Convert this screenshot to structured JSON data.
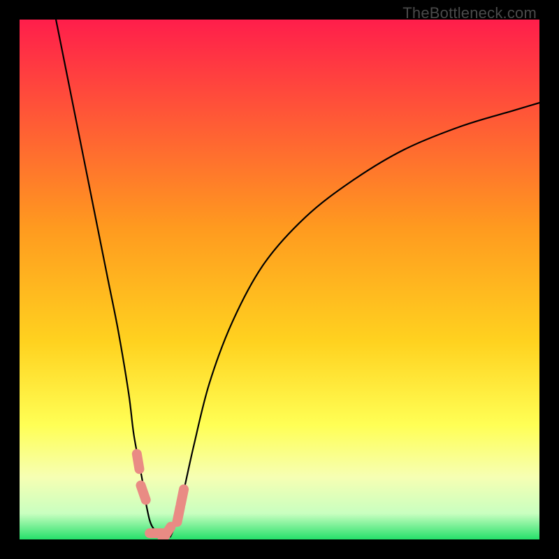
{
  "watermark": "TheBottleneck.com",
  "chart_data": {
    "type": "line",
    "title": "",
    "xlabel": "",
    "ylabel": "",
    "xlim": [
      0,
      100
    ],
    "ylim": [
      0,
      100
    ],
    "gradient_stops": [
      {
        "offset": 0.0,
        "color": "#ff1e4b"
      },
      {
        "offset": 0.4,
        "color": "#ff9a1f"
      },
      {
        "offset": 0.62,
        "color": "#ffd21f"
      },
      {
        "offset": 0.78,
        "color": "#ffff55"
      },
      {
        "offset": 0.88,
        "color": "#f6ffb3"
      },
      {
        "offset": 0.95,
        "color": "#c9ffc0"
      },
      {
        "offset": 1.0,
        "color": "#25e06a"
      }
    ],
    "series": [
      {
        "name": "left-branch",
        "x": [
          7.0,
          9.0,
          11.0,
          13.0,
          15.0,
          17.0,
          19.0,
          21.0,
          22.0,
          23.5,
          24.5,
          25.5,
          27.5
        ],
        "y": [
          100.0,
          90.0,
          80.0,
          70.0,
          60.0,
          50.0,
          40.0,
          28.0,
          20.0,
          12.0,
          6.0,
          2.5,
          0.5
        ]
      },
      {
        "name": "right-branch",
        "x": [
          29.0,
          30.0,
          31.5,
          33.5,
          36.5,
          41.0,
          47.0,
          55.0,
          64.0,
          74.0,
          85.0,
          95.0,
          100.0
        ],
        "y": [
          0.5,
          3.0,
          9.0,
          18.0,
          30.0,
          42.0,
          53.0,
          62.0,
          69.0,
          75.0,
          79.5,
          82.5,
          84.0
        ]
      }
    ],
    "markers": {
      "name": "highlight-points",
      "color": "#e98b84",
      "points": [
        {
          "x": 22.8,
          "y": 15.0
        },
        {
          "x": 23.8,
          "y": 9.0
        },
        {
          "x": 26.5,
          "y": 1.2
        },
        {
          "x": 28.3,
          "y": 1.2
        },
        {
          "x": 30.6,
          "y": 4.8
        },
        {
          "x": 31.3,
          "y": 8.2
        }
      ]
    }
  }
}
